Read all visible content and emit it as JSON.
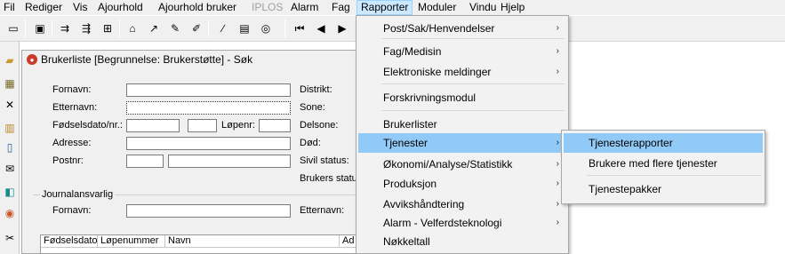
{
  "menubar": {
    "items": [
      "Fil",
      "Rediger",
      "Vis",
      "Ajourhold",
      "Ajourhold bruker",
      "IPLOS",
      "Alarm",
      "Fag",
      "Rapporter",
      "Moduler",
      "Vindu",
      "Hjelp"
    ]
  },
  "toolbar": {
    "icons": [
      "folder-icon",
      "save-icon",
      "tree-expand-icon",
      "tree-collapse-icon",
      "tree-icon",
      "lock-icon",
      "rocket-icon",
      "tools-icon",
      "pen-icon",
      "card-icon",
      "cd-icon",
      "first-icon",
      "prev-icon",
      "play-icon"
    ]
  },
  "sidestrip": {
    "icons": [
      "open-folder-icon",
      "calendar-icon",
      "tools-icon",
      "archive-icon",
      "clipboard-icon",
      "mail-icon",
      "book-icon",
      "people-icon",
      "settings-icon"
    ]
  },
  "window": {
    "title": "Brukerliste [Begrunnelse: Brukerstøtte] - Søk",
    "fornavn_label": "Fornavn:",
    "etternavn_label": "Etternavn:",
    "fodselsdato_label": "Fødselsdato/nr.:",
    "lopenr_label": "Løpenr:",
    "adresse_label": "Adresse:",
    "postnr_label": "Postnr:",
    "distrikt_label": "Distrikt:",
    "sone_label": "Sone:",
    "delsone_label": "Delsone:",
    "dod_label": "Død:",
    "sivil_label": "Sivil status:",
    "brukers_label": "Brukers status",
    "journal_group": "Journalansvarlig",
    "journal_fornavn_label": "Fornavn:",
    "journal_etternavn_label": "Etternavn:",
    "columns": [
      "Fødselsdato",
      "Løpenummer",
      "Navn",
      "Ad"
    ]
  },
  "rapporter_menu": {
    "items": [
      {
        "label": "Post/Sak/Henvendelser",
        "submenu": true
      },
      {
        "label": "Fag/Medisin",
        "submenu": true
      },
      {
        "label": "Elektroniske meldinger",
        "submenu": true
      },
      {
        "label": "Forskrivningsmodul",
        "submenu": false
      },
      {
        "label": "Brukerlister",
        "submenu": false
      },
      {
        "label": "Tjenester",
        "submenu": true
      },
      {
        "label": "Økonomi/Analyse/Statistikk",
        "submenu": true
      },
      {
        "label": "Produksjon",
        "submenu": true
      },
      {
        "label": "Avvikshåndtering",
        "submenu": true
      },
      {
        "label": "Alarm - Velferdsteknologi",
        "submenu": true
      },
      {
        "label": "Nøkkeltall",
        "submenu": false
      }
    ],
    "highlighted": "Tjenester"
  },
  "tjenester_submenu": {
    "items": [
      "Tjenesterapporter",
      "Brukere med flere tjenester",
      "Tjenestepakker"
    ],
    "highlighted": "Tjenesterapporter"
  },
  "arrow_glyph": "›"
}
